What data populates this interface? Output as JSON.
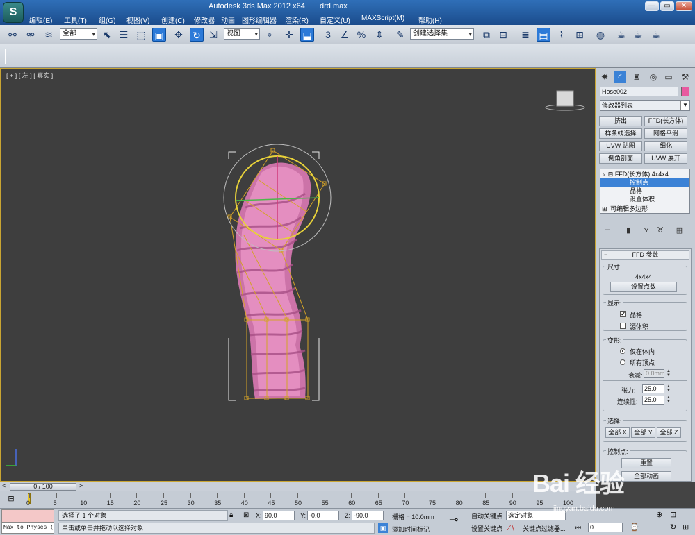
{
  "window": {
    "title": "Autodesk 3ds Max  2012 x64",
    "file": "drd.max",
    "logo": "S"
  },
  "menu": [
    "编辑(E)",
    "工具(T)",
    "组(G)",
    "视图(V)",
    "创建(C)",
    "修改器",
    "动画",
    "图形编辑器",
    "渲染(R)",
    "自定义(U)",
    "MAXScript(M)",
    "帮助(H)"
  ],
  "toolbar": {
    "filter_value": "全部",
    "coord_value": "视图",
    "selset_value": "创建选择集"
  },
  "viewport": {
    "label": "[ + ] [ 左 ] [ 真实 ]",
    "viewcube_label": "左"
  },
  "command_panel": {
    "object_name": "Hose002",
    "object_color": "#e85aa0",
    "modifier_list": "修改器列表",
    "modifier_buttons": [
      "挤出",
      "FFD(长方体)",
      "样条线选择",
      "网格平滑",
      "UVW 贴图",
      "细化",
      "倒角剖面",
      "UVW 展开"
    ],
    "stack": [
      {
        "label": "FFD(长方体) 4x4x4",
        "selected": false
      },
      {
        "label": "控制点",
        "selected": true
      },
      {
        "label": "晶格",
        "selected": false
      },
      {
        "label": "设置体积",
        "selected": false
      },
      {
        "label": "可编辑多边形",
        "selected": false
      }
    ],
    "rollout": {
      "title": "FFD 参数",
      "dims_group": "尺寸:",
      "dims_value": "4x4x4",
      "set_points_btn": "设置点数",
      "display_group": "显示:",
      "lattice_label": "晶格",
      "lattice_checked": true,
      "source_volume_label": "源体积",
      "source_volume_checked": false,
      "deform_group": "变形:",
      "only_in_volume": "仅在体内",
      "all_vertices": "所有顶点",
      "falloff_label": "衰减:",
      "falloff_value": "0.0mm",
      "tension_label": "张力:",
      "tension_value": "25.0",
      "continuity_label": "连续性:",
      "continuity_value": "25.0",
      "select_group": "选择:",
      "all_x": "全部 X",
      "all_y": "全部 Y",
      "all_z": "全部 Z",
      "control_points_group": "控制点:",
      "reset_btn": "重置",
      "animate_all_btn": "全部动画"
    }
  },
  "timeline": {
    "slider_label": "0 / 100",
    "ticks": [
      "0",
      "5",
      "10",
      "15",
      "20",
      "25",
      "30",
      "35",
      "40",
      "45",
      "50",
      "55",
      "60",
      "65",
      "70",
      "75",
      "80",
      "85",
      "90",
      "95",
      "100"
    ]
  },
  "status": {
    "maxscript": "Max to Physcs (",
    "selection": "选择了 1 个对象",
    "hint": "单击或单击并拖动以选择对象",
    "x_label": "X:",
    "x_value": "90.0",
    "y_label": "Y:",
    "y_value": "-0.0",
    "z_label": "Z:",
    "z_value": "-90.0",
    "grid": "栅格 = 10.0mm",
    "add_time_tag": "添加时间标记",
    "auto_key": "自动关键点",
    "auto_key_value": "选定对象",
    "set_key": "设置关键点",
    "key_filters": "关键点过滤器...",
    "frame_value": "0"
  },
  "watermark": {
    "logo": "Bai 经验",
    "url": "jingyan.baidu.com"
  }
}
